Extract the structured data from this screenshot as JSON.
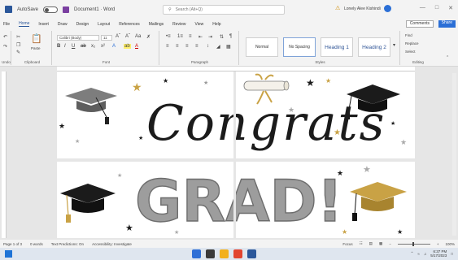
{
  "titlebar": {
    "autosave_label": "AutoSave",
    "toggle_state": "On",
    "doc_title": "Document1 · Word",
    "search_placeholder": "Search (Alt+Q)",
    "user_name": "Lonely Alee Kishindi",
    "window_controls": [
      "—",
      "□",
      "✕"
    ]
  },
  "menu": {
    "tabs": [
      "File",
      "Home",
      "Insert",
      "Draw",
      "Design",
      "Layout",
      "References",
      "Mailings",
      "Review",
      "View",
      "Help"
    ],
    "active": "Home",
    "comments_label": "Comments",
    "share_label": "Share"
  },
  "ribbon": {
    "clipboard_label": "Clipboard",
    "paste_label": "Paste",
    "font_name": "Calibri (Body)",
    "font_size": "11",
    "font_label": "Font",
    "paragraph_label": "Paragraph",
    "styles_label": "Styles",
    "editing_label": "Editing",
    "undo_label": "Undo",
    "styles": [
      "Normal",
      "No Spacing",
      "Heading 1",
      "Heading 2"
    ],
    "editing_items": [
      "Find",
      "Replace",
      "Select"
    ],
    "format_glyphs": [
      "B",
      "I",
      "U",
      "ab",
      "x₂",
      "x²",
      "A",
      "A"
    ],
    "para_glyphs": [
      "≡",
      "≡",
      "≡",
      "≡",
      "¶"
    ]
  },
  "document": {
    "banner_text_1": "Congrats",
    "banner_text_2": "GRAD!"
  },
  "statusbar": {
    "page_info": "Page 1 of 3",
    "words": "0 words",
    "text_predictions": "Text Predictions: On",
    "accessibility": "Accessibility: Investigate",
    "focus_label": "Focus",
    "zoom": "100%"
  },
  "taskbar": {
    "time": "6:37 PM",
    "date": "5/17/2023"
  },
  "colors": {
    "word_blue": "#2b579a",
    "gold": "#c9a245",
    "gray_text": "#9d9d9d",
    "cap_black": "#1b1b1b"
  }
}
